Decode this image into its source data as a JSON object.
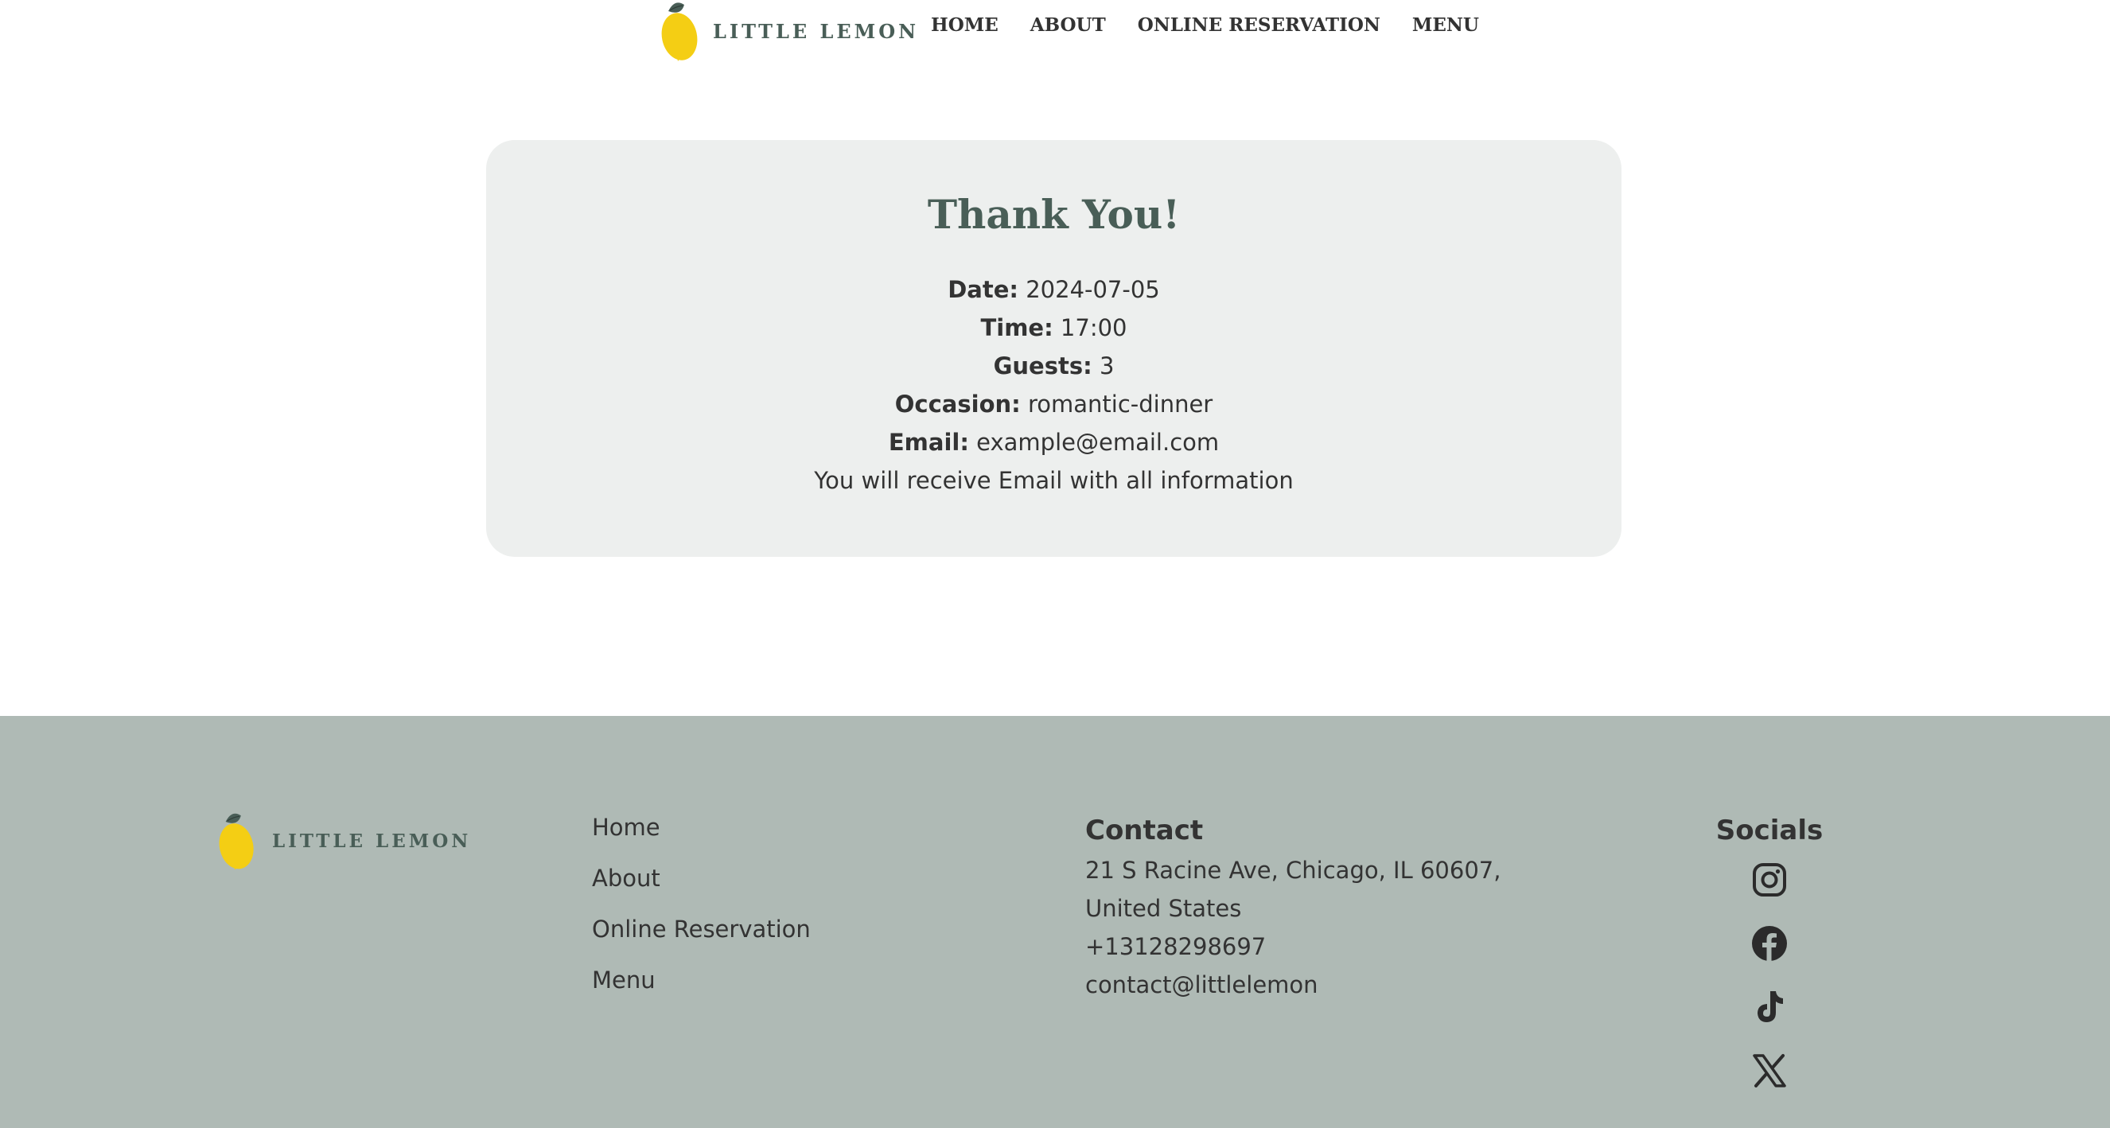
{
  "header": {
    "brand": "LITTLE LEMON",
    "nav": [
      {
        "label": "HOME"
      },
      {
        "label": "ABOUT"
      },
      {
        "label": "ONLINE RESERVATION"
      },
      {
        "label": "MENU"
      }
    ]
  },
  "confirmation": {
    "title": "Thank You!",
    "date_label": "Date:",
    "date_value": "2024-07-05",
    "time_label": "Time:",
    "time_value": "17:00",
    "guests_label": "Guests:",
    "guests_value": "3",
    "occasion_label": "Occasion:",
    "occasion_value": "romantic-dinner",
    "email_label": "Email:",
    "email_value": "example@email.com",
    "note": "You will receive Email with all information"
  },
  "footer": {
    "brand": "LITTLE LEMON",
    "links": [
      {
        "label": "Home"
      },
      {
        "label": "About"
      },
      {
        "label": "Online Reservation"
      },
      {
        "label": "Menu"
      }
    ],
    "contact": {
      "heading": "Contact",
      "address": "21 S Racine Ave, Chicago, IL 60607, United States",
      "phone": "+13128298697",
      "email": "contact@littlelemon"
    },
    "socials": {
      "heading": "Socials",
      "icons": [
        "instagram-icon",
        "facebook-icon",
        "tiktok-icon",
        "x-icon"
      ]
    }
  },
  "colors": {
    "brand_green": "#495e57",
    "lemon_yellow": "#f4ce14",
    "card_bg": "#edefee",
    "footer_bg": "#afbab5",
    "text": "#333333"
  }
}
